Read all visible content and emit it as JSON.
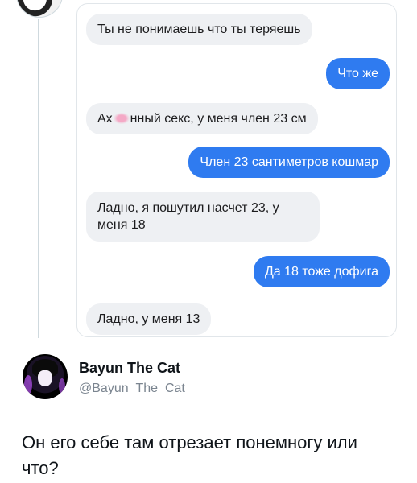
{
  "chat": {
    "messages": [
      {
        "side": "in",
        "text": "Ты не понимаешь что ты теряешь"
      },
      {
        "side": "out",
        "text": "Что же"
      },
      {
        "side": "in",
        "text_start": "Ах",
        "text_end": "нный секс, у меня член 23 см"
      },
      {
        "side": "out",
        "text": "Член 23 сантиметров кошмар"
      },
      {
        "side": "in",
        "text": "Ладно, я пошутил насчет 23, у меня 18"
      },
      {
        "side": "out",
        "text": "Да 18 тоже дофига"
      },
      {
        "side": "in",
        "text": "Ладно, у меня 13"
      }
    ],
    "incoming_color": "#eef0f3",
    "outgoing_color": "#2f7bf0"
  },
  "author": {
    "name": "Bayun The Cat",
    "handle": "@Bayun_The_Cat"
  },
  "post": {
    "text": "Он его себе там отрезает понемногу или что?"
  }
}
